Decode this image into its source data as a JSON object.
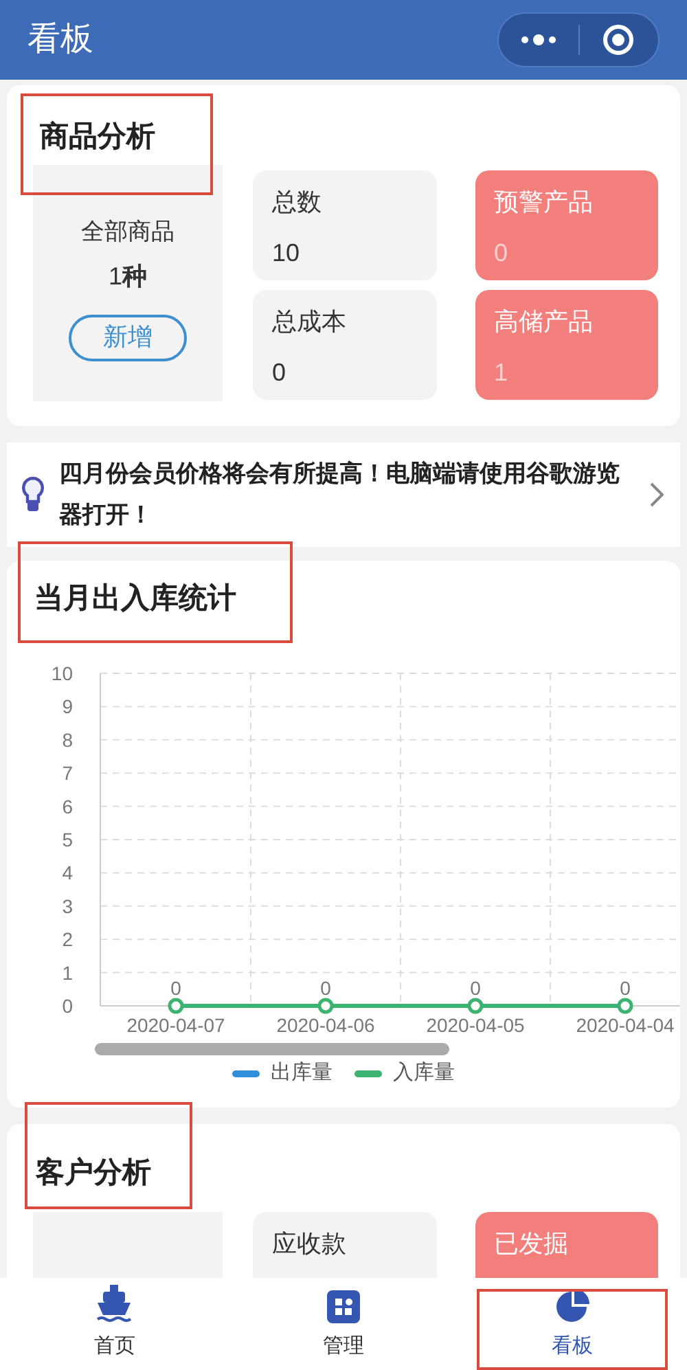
{
  "header": {
    "title": "看板"
  },
  "product_analysis": {
    "title": "商品分析",
    "highlighted": true,
    "summary": {
      "label": "全部商品",
      "count": "1",
      "unit": "种",
      "button": "新增"
    },
    "stats": [
      {
        "label": "总数",
        "value": "10",
        "alert": false
      },
      {
        "label": "预警产品",
        "value": "0",
        "alert": true
      },
      {
        "label": "总成本",
        "value": "0",
        "alert": false
      },
      {
        "label": "高储产品",
        "value": "1",
        "alert": true
      }
    ]
  },
  "notice": {
    "text": "四月份会员价格将会有所提高！电脑端请使用谷歌游览器打开！"
  },
  "stock_chart": {
    "title": "当月出入库统计",
    "highlighted": true,
    "chart_data": {
      "type": "line",
      "categories": [
        "2020-04-07",
        "2020-04-06",
        "2020-04-05",
        "2020-04-04"
      ],
      "ylim": [
        0,
        10
      ],
      "yticks": [
        0,
        1,
        2,
        3,
        4,
        5,
        6,
        7,
        8,
        9,
        10
      ],
      "data_labels": true,
      "grid": true,
      "series": [
        {
          "name": "出库量",
          "color": "#2f8fd8",
          "values": [
            null,
            null,
            null,
            null
          ]
        },
        {
          "name": "入库量",
          "color": "#3cb371",
          "marker": true,
          "values": [
            0,
            0,
            0,
            0
          ]
        }
      ]
    }
  },
  "customer_analysis": {
    "title": "客户分析",
    "highlighted": true,
    "stats": [
      {
        "label": "应收款",
        "alert": false
      },
      {
        "label": "已发掘",
        "alert": true
      }
    ]
  },
  "tabs": [
    {
      "label": "首页",
      "kind": "ship",
      "selected": false,
      "highlighted": false
    },
    {
      "label": "管理",
      "kind": "grid",
      "selected": false,
      "highlighted": false
    },
    {
      "label": "看板",
      "kind": "pie",
      "selected": true,
      "highlighted": true
    }
  ]
}
